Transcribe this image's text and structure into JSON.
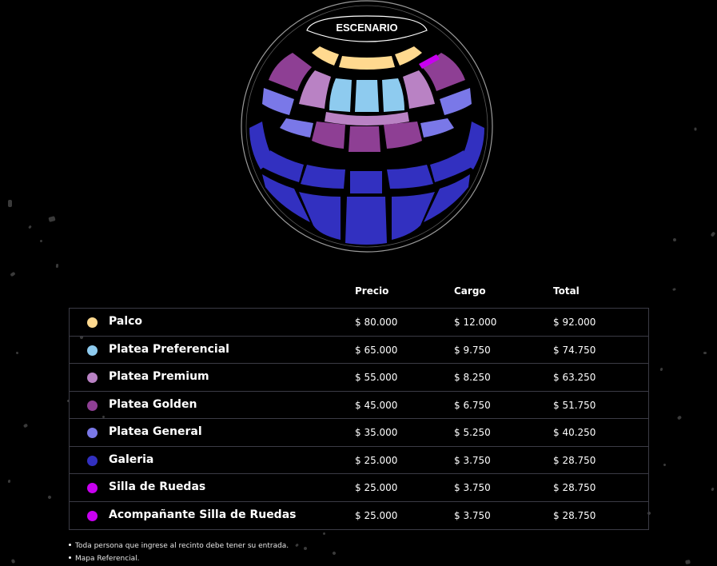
{
  "stage_label": "ESCENARIO",
  "columns": {
    "precio": "Precio",
    "cargo": "Cargo",
    "total": "Total"
  },
  "zones": [
    {
      "name": "Palco",
      "color": "#ffd98f",
      "precio": "$ 80.000",
      "cargo": "$ 12.000",
      "total": "$ 92.000"
    },
    {
      "name": "Platea Preferencial",
      "color": "#8ecbef",
      "precio": "$ 65.000",
      "cargo": "$ 9.750",
      "total": "$ 74.750"
    },
    {
      "name": "Platea Premium",
      "color": "#b982c4",
      "precio": "$ 55.000",
      "cargo": "$ 8.250",
      "total": "$ 63.250"
    },
    {
      "name": "Platea Golden",
      "color": "#8e3f94",
      "precio": "$ 45.000",
      "cargo": "$ 6.750",
      "total": "$ 51.750"
    },
    {
      "name": "Platea General",
      "color": "#7a78e8",
      "precio": "$ 35.000",
      "cargo": "$ 5.250",
      "total": "$ 40.250"
    },
    {
      "name": "Galeria",
      "color": "#3230c0",
      "precio": "$ 25.000",
      "cargo": "$ 3.750",
      "total": "$ 28.750"
    },
    {
      "name": "Silla de Ruedas",
      "color": "#c800f0",
      "precio": "$ 25.000",
      "cargo": "$ 3.750",
      "total": "$ 28.750"
    },
    {
      "name": "Acompañante Silla de Ruedas",
      "color": "#c800f0",
      "precio": "$ 25.000",
      "cargo": "$ 3.750",
      "total": "$ 28.750"
    }
  ],
  "notes": [
    "Toda persona que ingrese al recinto debe tener su entrada.",
    "Mapa Referencial."
  ]
}
